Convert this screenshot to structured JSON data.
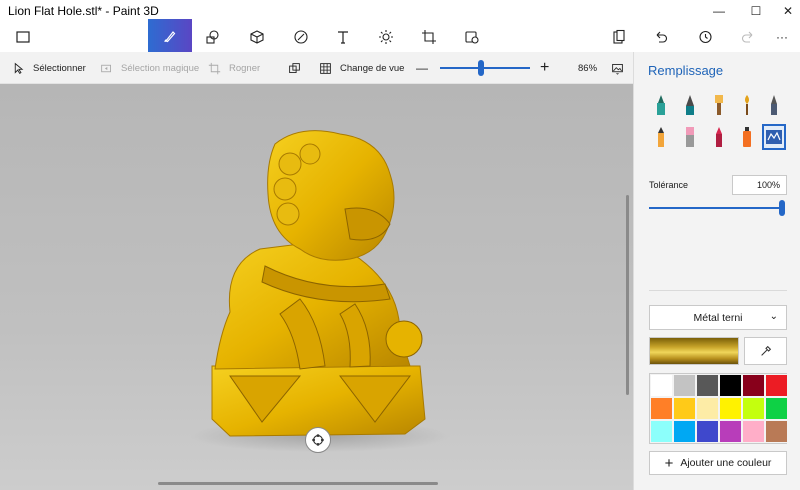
{
  "window": {
    "title": "Lion Flat Hole.stl* - Paint 3D",
    "minimize": "—",
    "maximize": "☐",
    "close": "✕"
  },
  "toolbar": {
    "tools": [
      {
        "name": "brushes-icon",
        "active": true
      },
      {
        "name": "2d-shapes-icon"
      },
      {
        "name": "3d-shapes-icon"
      },
      {
        "name": "stickers-icon"
      },
      {
        "name": "text-icon"
      },
      {
        "name": "effects-icon"
      },
      {
        "name": "canvas-icon"
      },
      {
        "name": "3d-library-icon"
      }
    ],
    "more": "···"
  },
  "subbar": {
    "select": "Sélectionner",
    "magic_select": "Sélection magique",
    "crop": "Rogner",
    "change_view": "Change de vue",
    "zoom_minus": "—",
    "zoom_plus": "+",
    "zoom_level": "86%",
    "zoom_fraction": 0.45
  },
  "panel": {
    "title": "Remplissage",
    "tolerance_label": "Tolérance",
    "tolerance_value": "100%",
    "tolerance_fraction": 1.0,
    "material": "Métal terni",
    "add_color": "Ajouter une couleur"
  },
  "colors": {
    "accent": "#2467c7",
    "current": "#c9a52a",
    "palette": [
      "#ffffff",
      "#c3c3c3",
      "#585858",
      "#000000",
      "#88001b",
      "#ec1c24",
      "#ff7f27",
      "#ffca18",
      "#fdeca6",
      "#fff200",
      "#c4ff0e",
      "#0ed145",
      "#8cfffb",
      "#00a8f3",
      "#3f48cc",
      "#b83dba",
      "#ffaec8",
      "#b97a56"
    ]
  }
}
